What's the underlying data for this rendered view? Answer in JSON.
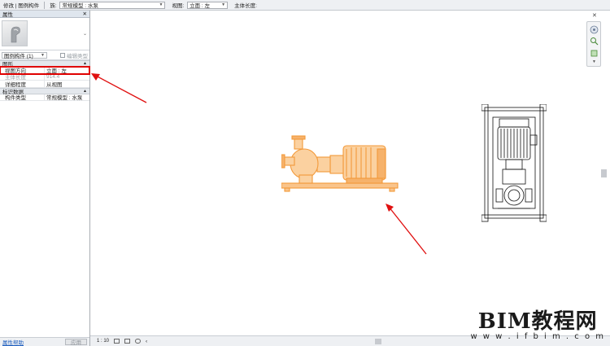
{
  "options_bar": {
    "modify_label": "修改 | 图例构件",
    "family_label": "族:",
    "family_value": "常规模型 : 水泵",
    "view_label": "视图:",
    "view_value": "立面 : 左",
    "host_length_label": "主体长度:"
  },
  "properties": {
    "title": "属性",
    "close": "✕",
    "type_selector_caret": "⌄",
    "filter_value": "图例构件 (1)",
    "edit_type_label": "编辑类型",
    "groups": [
      {
        "name": "图形",
        "rows": [
          {
            "key": "视图方向",
            "value": "立面 : 左"
          },
          {
            "key": "主体长度",
            "value": "914.4"
          },
          {
            "key": "详细程度",
            "value": "从视图"
          }
        ]
      },
      {
        "name": "标识数据",
        "rows": [
          {
            "key": "构件类型",
            "value": "常规模型 : 水泵"
          }
        ]
      }
    ],
    "help_link": "属性帮助",
    "apply_button": "应用"
  },
  "status_bar": {
    "scale": "1 : 10",
    "chevron": "‹"
  },
  "colors": {
    "pump_orange": "#f39a3a",
    "highlight_red": "#e00000",
    "arrow_red": "#e01010"
  },
  "watermark": {
    "title": "BIM教程网",
    "url": "w w w . i f b i m . c o m"
  }
}
